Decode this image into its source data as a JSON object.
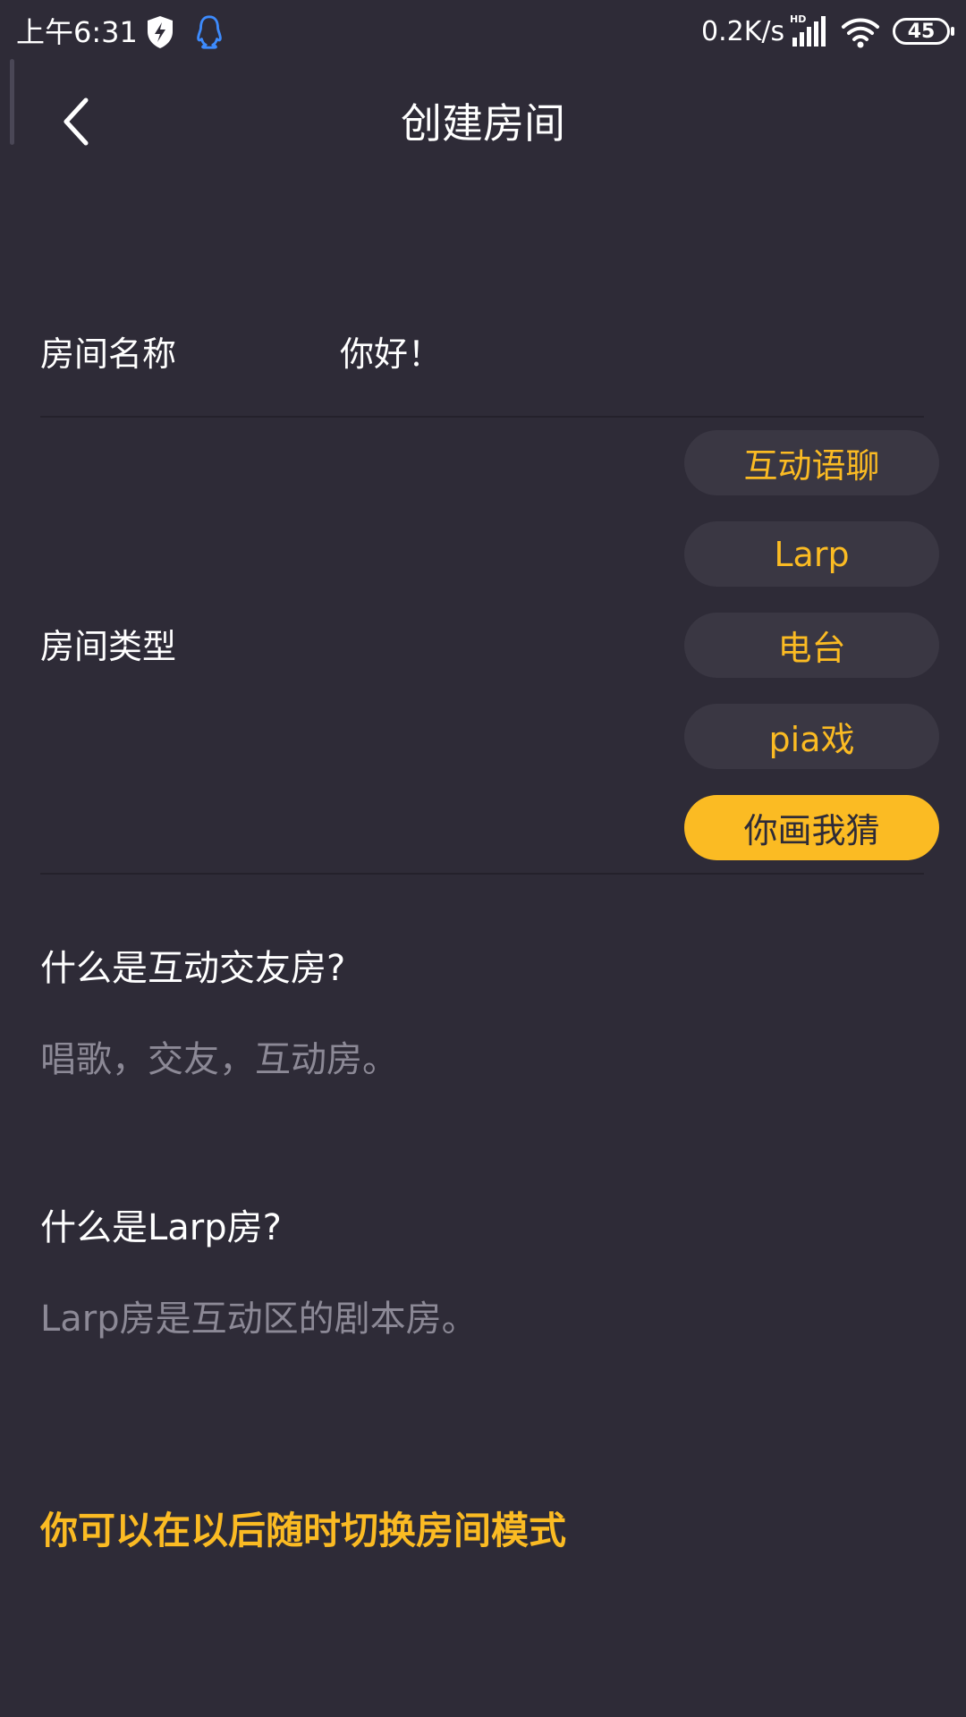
{
  "status_bar": {
    "time": "上午6:31",
    "network_speed": "0.2K/s",
    "network_badge": "HD",
    "battery_level": "45"
  },
  "header": {
    "title": "创建房间"
  },
  "room_name": {
    "label": "房间名称",
    "value": "你好！"
  },
  "room_type": {
    "label": "房间类型",
    "options": [
      {
        "label": "互动语聊",
        "selected": false
      },
      {
        "label": "Larp",
        "selected": false
      },
      {
        "label": "电台",
        "selected": false
      },
      {
        "label": "pia戏",
        "selected": false
      },
      {
        "label": "你画我猜",
        "selected": true
      }
    ]
  },
  "faq": [
    {
      "question": "什么是互动交友房?",
      "answer": "唱歌，交友，互动房。"
    },
    {
      "question": "什么是Larp房?",
      "answer": "Larp房是互动区的剧本房。"
    }
  ],
  "footer_note": "你可以在以后随时切换房间模式",
  "colors": {
    "background": "#2e2b37",
    "accent": "#fbbb23",
    "option_background": "#3a3743",
    "muted_text": "#8c8996"
  }
}
